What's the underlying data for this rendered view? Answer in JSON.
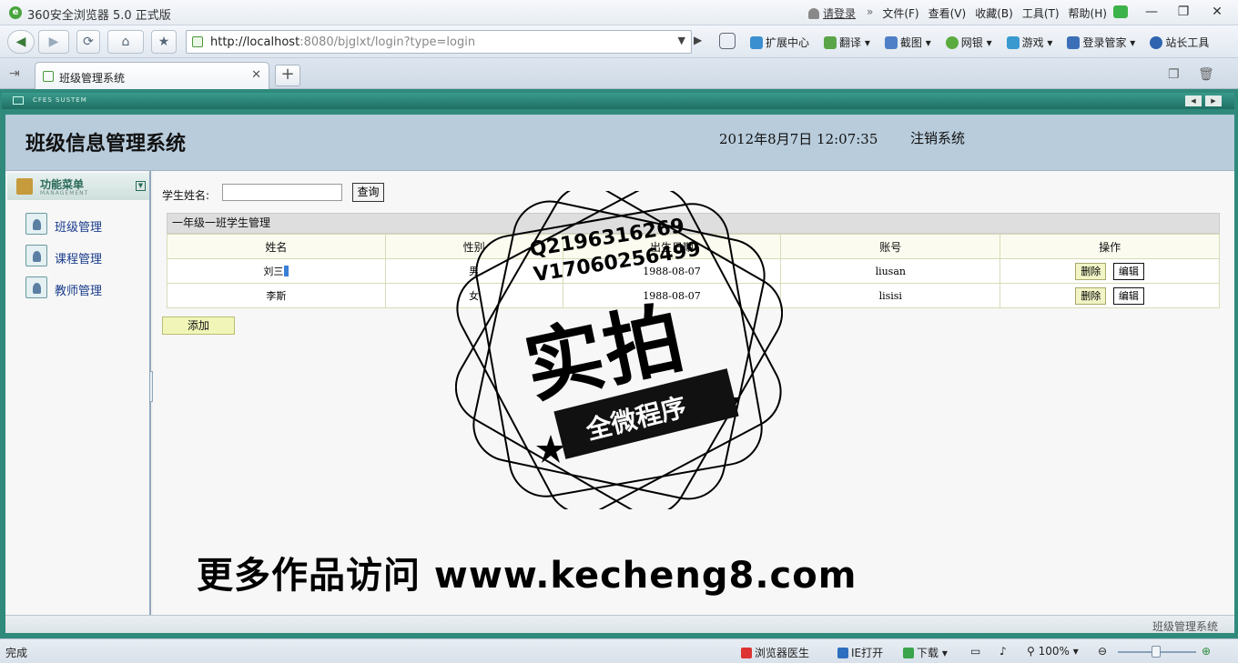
{
  "browser": {
    "title": "360安全浏览器 5.0 正式版",
    "login_link": "请登录",
    "menus": [
      "文件(F)",
      "查看(V)",
      "收藏(B)",
      "工具(T)",
      "帮助(H)"
    ],
    "address_host": "http://localhost",
    "address_rest": ":8080/bjglxt/login?type=login",
    "toolbar_items": [
      "扩展中心",
      "翻译",
      "截图",
      "网银",
      "游戏",
      "登录管家",
      "站长工具"
    ],
    "tab_label": "班级管理系统",
    "window_controls": {
      "minimize": "—",
      "restore": "❐",
      "close": "✕"
    }
  },
  "frame": {
    "cfes_label": "CFES SUSTEM"
  },
  "app": {
    "title": "班级信息管理系统",
    "datetime": "2012年8月7日 12:07:35",
    "logout": "注销系统",
    "menu_title": "功能菜单",
    "menu_subtitle": "MANAGEMENT",
    "nav": [
      "班级管理",
      "课程管理",
      "教师管理"
    ],
    "search_label": "学生姓名:",
    "search_value": "",
    "search_button": "查询",
    "grid_title": "一年级一班学生管理",
    "columns": [
      "姓名",
      "性别",
      "出生日期",
      "账号",
      "操作"
    ],
    "rows": [
      {
        "name": "刘三",
        "gender": "男",
        "birth": "1988-08-07",
        "account": "liusan"
      },
      {
        "name": "李斯",
        "gender": "女",
        "birth": "1988-08-07",
        "account": "lisisi"
      }
    ],
    "delete_label": "删除",
    "edit_label": "编辑",
    "add_button": "添加",
    "footer": "班级管理系统"
  },
  "statusbar": {
    "status": "完成",
    "doctor": "浏览器医生",
    "ie_open": "IE打开",
    "download": "下载",
    "zoom": "100%"
  },
  "watermark": {
    "contact_q": "Q2196316269",
    "contact_v": "V17060256499",
    "stamp_big": "实拍",
    "stamp_ribbon": "全微程序",
    "bottom_text": "更多作品访问 www.kecheng8.com"
  },
  "colors": {
    "frame_teal": "#2f8a7c",
    "header_blue": "#b8ccdc",
    "add_button": "#f1f6b8",
    "nav_link": "#1a3c8c"
  }
}
